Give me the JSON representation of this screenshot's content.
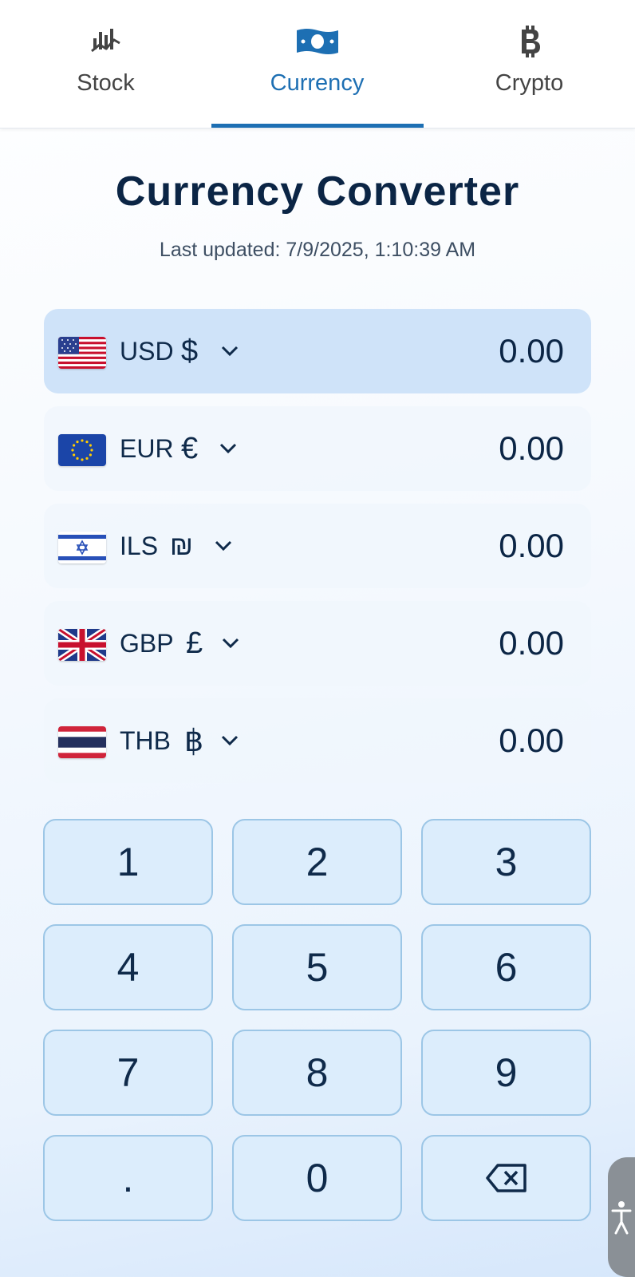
{
  "tabs": [
    {
      "label": "Stock",
      "icon": "stock-chart-icon",
      "active": false
    },
    {
      "label": "Currency",
      "icon": "banknote-icon",
      "active": true
    },
    {
      "label": "Crypto",
      "icon": "bitcoin-icon",
      "active": false
    }
  ],
  "title": "Currency Converter",
  "last_updated": "Last updated: 7/9/2025, 1:10:39 AM",
  "currencies": [
    {
      "code": "USD",
      "symbol": "$",
      "amount": "0.00",
      "flag": "us-flag-icon",
      "selected": true
    },
    {
      "code": "EUR",
      "symbol": "€",
      "amount": "0.00",
      "flag": "eu-flag-icon",
      "selected": false
    },
    {
      "code": "ILS",
      "symbol": "₪",
      "amount": "0.00",
      "flag": "israel-flag-icon",
      "selected": false
    },
    {
      "code": "GBP",
      "symbol": "£",
      "amount": "0.00",
      "flag": "uk-flag-icon",
      "selected": false
    },
    {
      "code": "THB",
      "symbol": "฿",
      "amount": "0.00",
      "flag": "thailand-flag-icon",
      "selected": false
    }
  ],
  "keypad": [
    "1",
    "2",
    "3",
    "4",
    "5",
    "6",
    "7",
    "8",
    "9",
    ".",
    "0"
  ],
  "backspace_icon": "backspace-icon",
  "colors": {
    "accent": "#1d6fb3",
    "selected_row": "#cfe3f9",
    "key_bg": "#dcedfc",
    "key_border": "#9cc6e6",
    "title": "#0b2545"
  }
}
